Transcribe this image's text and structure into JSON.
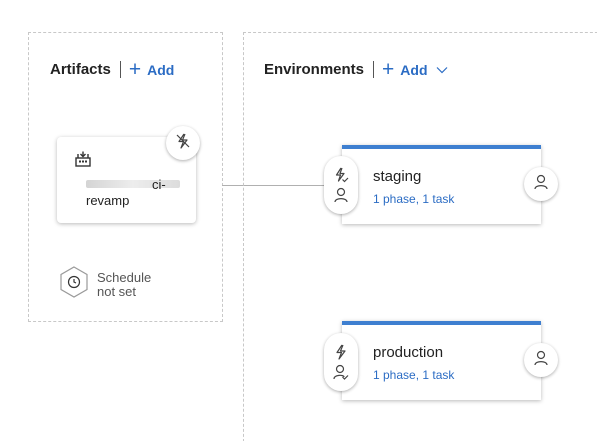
{
  "colors": {
    "accent": "#2b6cc4",
    "env_bar": "#3e7fd0",
    "border_dashed": "#c8c8c8",
    "text": "#222222"
  },
  "artifacts": {
    "title": "Artifacts",
    "add_label": "Add",
    "card": {
      "icon": "build-icon",
      "name_line1": "ci-",
      "name_line2": "revamp",
      "trigger_icon": "lightning-disabled-icon"
    },
    "schedule": {
      "icon": "clock-icon",
      "line1": "Schedule",
      "line2": "not set"
    }
  },
  "environments": {
    "title": "Environments",
    "add_label": "Add",
    "items": [
      {
        "name": "staging",
        "summary": "1 phase, 1 task",
        "pre_trigger_icon": "lightning-check-icon",
        "pre_approval_icon": "person-icon",
        "post_approval_icon": "person-icon"
      },
      {
        "name": "production",
        "summary": "1 phase, 1 task",
        "pre_trigger_icon": "lightning-icon",
        "pre_approval_icon": "person-check-icon",
        "post_approval_icon": "person-icon"
      }
    ]
  }
}
